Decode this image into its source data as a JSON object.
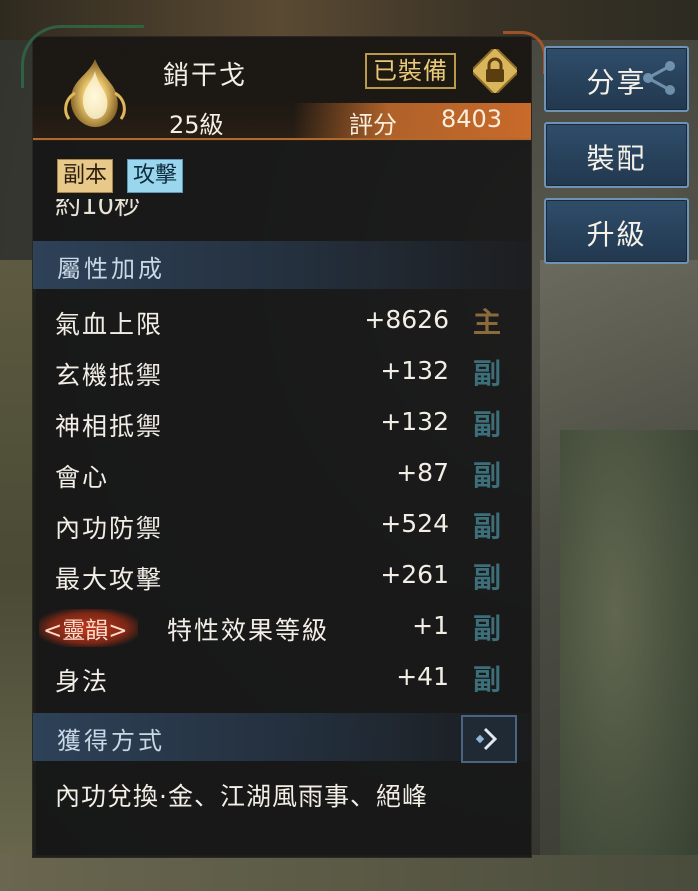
{
  "item": {
    "name": "銷干戈",
    "level": "25級",
    "equipped_label": "已裝備",
    "score_label": "評分",
    "score_value": "8403"
  },
  "tags": [
    "副本",
    "攻擊"
  ],
  "cut_text": "約10秒",
  "attributes": {
    "title": "屬性加成",
    "rows": [
      {
        "label": "氣血上限",
        "value": "+8626",
        "kind": "主"
      },
      {
        "label": "玄機抵禦",
        "value": "+132",
        "kind": "副"
      },
      {
        "label": "神相抵禦",
        "value": "+132",
        "kind": "副"
      },
      {
        "label": "會心",
        "value": "+87",
        "kind": "副"
      },
      {
        "label": "內功防禦",
        "value": "+524",
        "kind": "副"
      },
      {
        "label": "最大攻擊",
        "value": "+261",
        "kind": "副"
      },
      {
        "spirit": "<靈韻>",
        "label": "特性效果等級",
        "value": "+1",
        "kind": "副"
      },
      {
        "label": "身法",
        "value": "+41",
        "kind": "副"
      }
    ]
  },
  "source": {
    "title": "獲得方式",
    "text": "內功兌換·金、江湖風雨事、絕峰"
  },
  "buttons": {
    "share": "分享",
    "equip": "裝配",
    "upgrade": "升級"
  },
  "colors": {
    "accent_orange": "#c86a2a",
    "tag_dungeon": "#e8c98a",
    "tag_attack": "#9ad6ee",
    "button_blue": "#2f4d6a"
  },
  "icons": {
    "item": "golden-flame-weapon-icon",
    "lock": "lock-icon",
    "share": "share-icon",
    "arrow": "arrow-right-icon"
  }
}
